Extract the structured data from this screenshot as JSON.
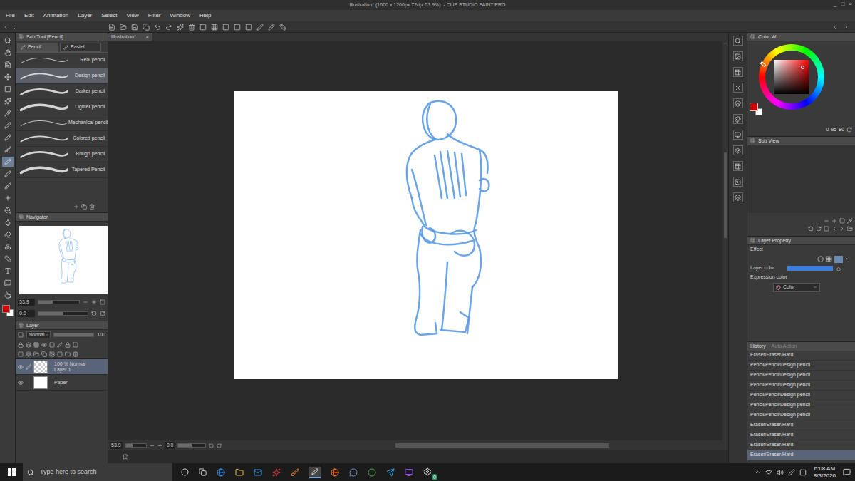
{
  "window": {
    "title": "Illustration* (1600 x 1200px 72dpi 53.9%)  - CLIP STUDIO PAINT PRO",
    "controls": [
      "_",
      "□",
      "×"
    ]
  },
  "menu": [
    "File",
    "Edit",
    "Animation",
    "Layer",
    "Select",
    "View",
    "Filter",
    "Window",
    "Help"
  ],
  "tools": [
    {
      "selected": false
    },
    {
      "selected": false
    },
    {
      "selected": false
    },
    {
      "selected": false
    },
    {
      "selected": false
    },
    {
      "selected": false
    },
    {
      "selected": false
    },
    {
      "selected": false
    },
    {
      "selected": false
    },
    {
      "selected": false
    },
    {
      "selected": true
    },
    {
      "selected": false
    },
    {
      "selected": false
    },
    {
      "selected": false
    },
    {
      "selected": false
    },
    {
      "selected": false
    },
    {
      "selected": false
    },
    {
      "selected": false
    },
    {
      "selected": false
    },
    {
      "selected": false
    },
    {
      "selected": false
    },
    {
      "selected": false
    }
  ],
  "sub_tool": {
    "title": "Sub Tool [Pencil]",
    "tabs": [
      {
        "label": "Pencil",
        "selected": true
      },
      {
        "label": "Pastel",
        "selected": false
      }
    ],
    "brushes": [
      {
        "label": "Real pencil",
        "selected": false
      },
      {
        "label": "Design pencil",
        "selected": true
      },
      {
        "label": "Darker pencil",
        "selected": false
      },
      {
        "label": "Lighter pencil",
        "selected": false
      },
      {
        "label": "Mechanical pencil",
        "selected": false
      },
      {
        "label": "Colored pencil",
        "selected": false
      },
      {
        "label": "Rough pencil",
        "selected": false
      },
      {
        "label": "Tapered Pencil",
        "selected": false
      }
    ]
  },
  "navigator": {
    "title": "Navigator",
    "zoom": "53.9",
    "zoom_level": 0.35,
    "rotation": "0.0",
    "rotation_level": 0.5
  },
  "main_color": "#cc0000",
  "sub_color": "#ffffff",
  "layer_panel": {
    "title": "Layer",
    "blend_mode": "Normal",
    "opacity": "100",
    "opacity_level": 1,
    "layers": [
      {
        "info": "100 % Normal",
        "name": "Layer 1",
        "selected": true,
        "visible": true,
        "kind": "raster"
      },
      {
        "info": "",
        "name": "Paper",
        "selected": false,
        "visible": true,
        "kind": "paper"
      }
    ]
  },
  "canvas": {
    "tab": "Illustration*",
    "tab_close": "×",
    "zoom": "53.9",
    "zoom_level": 0.35,
    "rotation": "0.0",
    "rotation_level": 0.5
  },
  "color_panel": {
    "title": "Color W...",
    "values": [
      "0",
      "95",
      "80"
    ]
  },
  "sub_view": {
    "title": "Sub View"
  },
  "layer_property": {
    "title": "Layer Property",
    "effect": "Effect",
    "layer_color_label": "Layer color",
    "layer_color": "#3a7fe0",
    "expression_label": "Expression color",
    "expression_value": "Color"
  },
  "history": {
    "tabs": [
      {
        "label": "History",
        "selected": true
      },
      {
        "label": "Auto Action",
        "selected": false
      }
    ],
    "items": [
      {
        "label": "Eraser/Eraser/Hard",
        "selected": false
      },
      {
        "label": "Pencil/Pencil/Design pencil",
        "selected": false
      },
      {
        "label": "Pencil/Pencil/Design pencil",
        "selected": false
      },
      {
        "label": "Pencil/Pencil/Design pencil",
        "selected": false
      },
      {
        "label": "Pencil/Pencil/Design pencil",
        "selected": false
      },
      {
        "label": "Pencil/Pencil/Design pencil",
        "selected": false
      },
      {
        "label": "Pencil/Pencil/Design pencil",
        "selected": false
      },
      {
        "label": "Eraser/Eraser/Hard",
        "selected": false
      },
      {
        "label": "Eraser/Eraser/Hard",
        "selected": false
      },
      {
        "label": "Eraser/Eraser/Hard",
        "selected": false
      },
      {
        "label": "Eraser/Eraser/Hard",
        "selected": true
      }
    ]
  },
  "taskbar": {
    "search": "Type here to search",
    "badge": "0",
    "time": "6:08 AM",
    "date": "8/3/2020"
  }
}
